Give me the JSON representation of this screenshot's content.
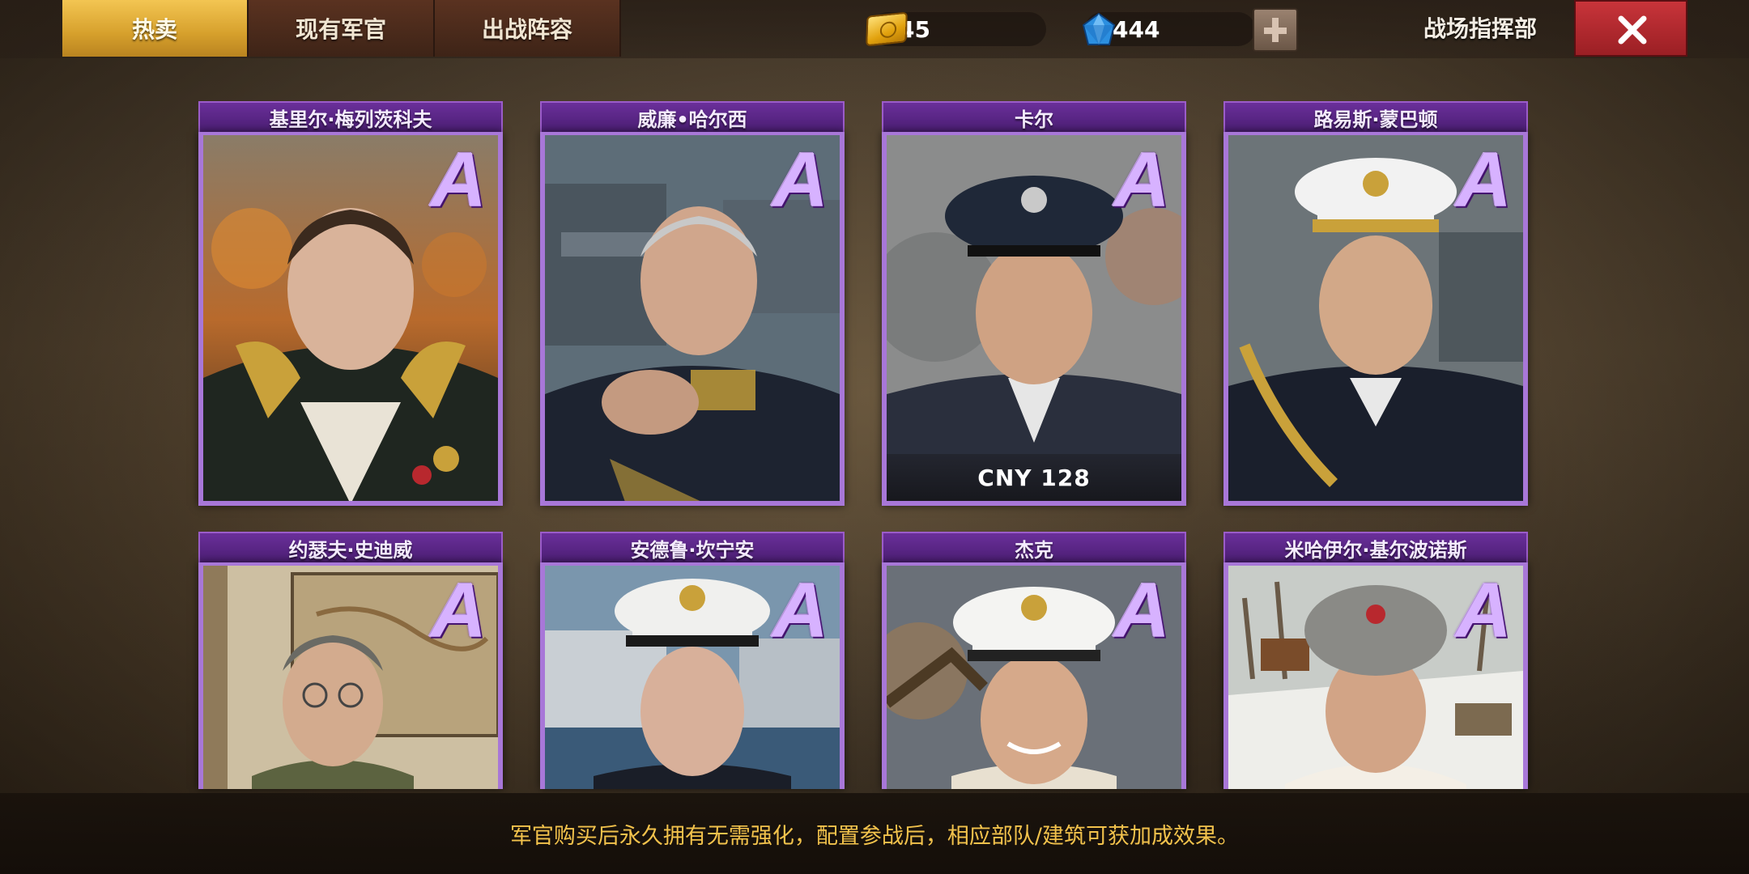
{
  "tabs": [
    {
      "label": "热卖",
      "active": true
    },
    {
      "label": "现有军官",
      "active": false
    },
    {
      "label": "出战阵容",
      "active": false
    }
  ],
  "currency": {
    "gold": {
      "icon": "gold-bar-icon",
      "value": "45"
    },
    "gems": {
      "icon": "blue-gem-icon",
      "value": "444"
    }
  },
  "header": {
    "hq_label": "战场指挥部"
  },
  "colors": {
    "active_tab": "#e0ac35",
    "card_purple": "#a877d8",
    "close_red": "#b8282e",
    "footer_text": "#f2c24c"
  },
  "officers": [
    {
      "name": "基里尔·梅列茨科夫",
      "grade": "A",
      "price": ""
    },
    {
      "name": "威廉•哈尔西",
      "grade": "A",
      "price": ""
    },
    {
      "name": "卡尔",
      "grade": "A",
      "price": "CNY 128"
    },
    {
      "name": "路易斯·蒙巴顿",
      "grade": "A",
      "price": ""
    },
    {
      "name": "约瑟夫·史迪威",
      "grade": "A",
      "price": ""
    },
    {
      "name": "安德鲁·坎宁安",
      "grade": "A",
      "price": ""
    },
    {
      "name": "杰克",
      "grade": "A",
      "price": ""
    },
    {
      "name": "米哈伊尔·基尔波诺斯",
      "grade": "A",
      "price": ""
    }
  ],
  "footer": {
    "text": "军官购买后永久拥有无需强化，配置参战后，相应部队/建筑可获加成效果。"
  }
}
